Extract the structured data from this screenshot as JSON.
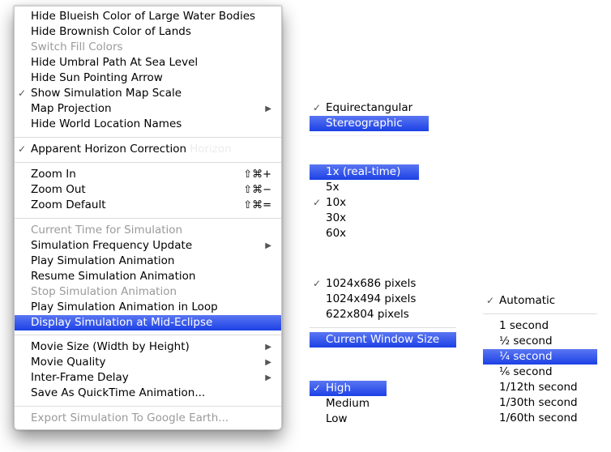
{
  "main_menu": {
    "items": [
      {
        "label": "Hide Blueish Color of Large Water Bodies"
      },
      {
        "label": "Hide Brownish Color of Lands"
      },
      {
        "label": "Switch Fill Colors",
        "disabled": true
      },
      {
        "label": "Hide Umbral Path At Sea Level"
      },
      {
        "label": "Hide Sun Pointing Arrow"
      },
      {
        "label": "Show Simulation Map Scale",
        "checked": true
      },
      {
        "label": "Map Projection",
        "submenu": true
      },
      {
        "label": "Hide World Location Names"
      },
      {
        "label": "Apparent Horizon Correction",
        "checked": true,
        "ghost_text": "Horizon"
      },
      {
        "label": "Zoom In",
        "shortcut": "⇧⌘+"
      },
      {
        "label": "Zoom Out",
        "shortcut": "⇧⌘−"
      },
      {
        "label": "Zoom Default",
        "shortcut": "⇧⌘="
      },
      {
        "label": "Current Time for Simulation",
        "disabled": true
      },
      {
        "label": "Simulation Frequency Update",
        "submenu": true
      },
      {
        "label": "Play Simulation Animation"
      },
      {
        "label": "Resume Simulation Animation"
      },
      {
        "label": "Stop Simulation Animation",
        "disabled": true
      },
      {
        "label": "Play Simulation Animation in Loop"
      },
      {
        "label": "Display Simulation at Mid-Eclipse",
        "highlighted": true
      },
      {
        "label": "Movie Size (Width by Height)",
        "submenu": true
      },
      {
        "label": "Movie Quality",
        "submenu": true
      },
      {
        "label": "Inter-Frame Delay",
        "submenu": true
      },
      {
        "label": "Save As QuickTime Animation..."
      },
      {
        "label": "Export Simulation To Google Earth...",
        "disabled": true
      }
    ],
    "check_glyph": "✓",
    "submenu_glyph": "▶"
  },
  "map_projection_submenu": {
    "items": [
      {
        "label": "Equirectangular",
        "checked": true
      },
      {
        "label": "Stereographic",
        "highlighted": true
      }
    ]
  },
  "frequency_submenu": {
    "items": [
      {
        "label": "1x (real-time)",
        "highlighted": true
      },
      {
        "label": "5x"
      },
      {
        "label": "10x",
        "checked": true
      },
      {
        "label": "30x"
      },
      {
        "label": "60x"
      }
    ]
  },
  "movie_size_submenu": {
    "items": [
      {
        "label": "1024x686 pixels",
        "checked": true
      },
      {
        "label": "1024x494 pixels"
      },
      {
        "label": "622x804 pixels"
      },
      {
        "label": "Current Window Size",
        "highlighted": true
      }
    ]
  },
  "movie_quality_submenu": {
    "items": [
      {
        "label": "High",
        "checked": true,
        "highlighted": true
      },
      {
        "label": "Medium"
      },
      {
        "label": "Low"
      }
    ]
  },
  "frame_delay_submenu": {
    "items": [
      {
        "label": "Automatic",
        "checked": true
      },
      {
        "label": "1 second"
      },
      {
        "label": "½ second"
      },
      {
        "label": "¼ second",
        "highlighted": true
      },
      {
        "label": "⅙ second"
      },
      {
        "label": "1/12th second"
      },
      {
        "label": "1/30th second"
      },
      {
        "label": "1/60th second"
      }
    ]
  },
  "colors": {
    "highlight": "#1c41e6",
    "disabled_text": "#9a9a9a"
  }
}
